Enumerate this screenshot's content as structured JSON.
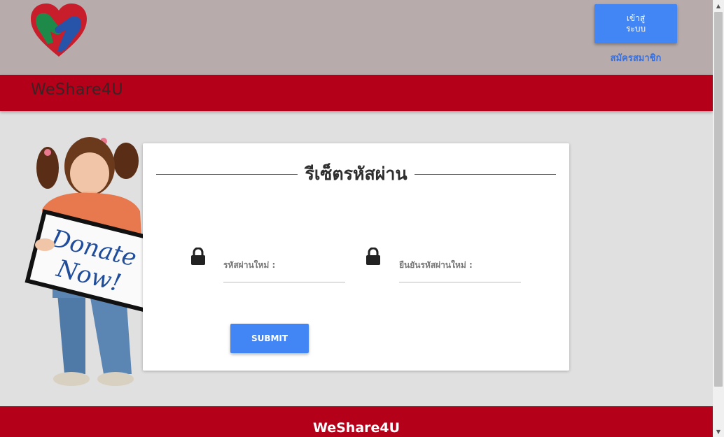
{
  "header": {
    "login_button_label": "เข้าสู่\nระบบ",
    "register_link_label": "สมัครสมาชิก"
  },
  "navbar": {
    "brand": "WeShare4U"
  },
  "banner_image": {
    "sign_text": "Donate Now!"
  },
  "reset_card": {
    "title": "รีเซ็ตรหัสผ่าน",
    "new_password_label": "รหัสผ่านใหม่ :",
    "confirm_password_label": "ยืนยันรหัสผ่านใหม่ :",
    "submit_label": "SUBMIT",
    "icon": "lock-icon"
  },
  "footer": {
    "brand": "WeShare4U"
  },
  "colors": {
    "topbar": "#b7abab",
    "brand_red": "#b5001a",
    "accent_blue": "#4285f4",
    "page_bg": "#e0e0e0"
  }
}
